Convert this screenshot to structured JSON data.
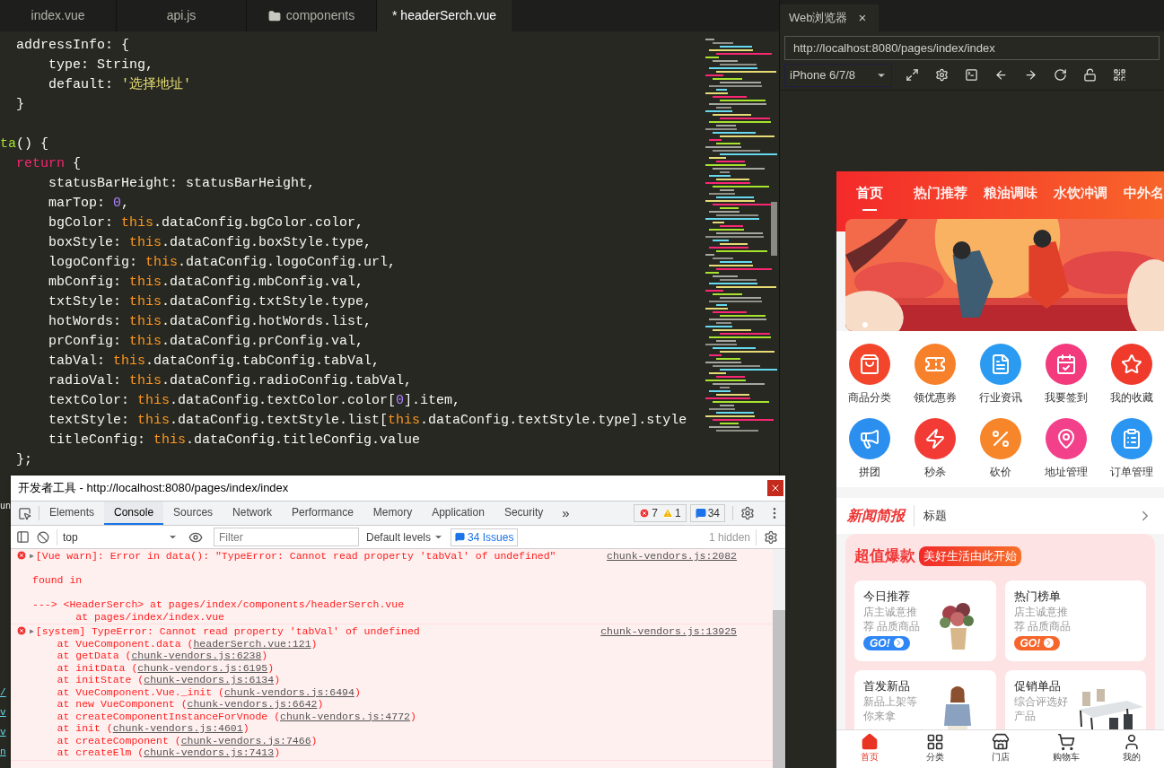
{
  "editor": {
    "tabs": [
      {
        "label": "index.vue",
        "kind": "file",
        "selected": false
      },
      {
        "label": "api.js",
        "kind": "file",
        "selected": false
      },
      {
        "label": "components",
        "kind": "folder",
        "selected": false
      },
      {
        "label": "* headerSerch.vue",
        "kind": "file",
        "selected": true
      }
    ],
    "code_lines": [
      {
        "tokens": [
          {
            "t": "  addressInfo: {",
            "kind": "plain"
          }
        ]
      },
      {
        "tokens": [
          {
            "t": "      type: String,",
            "kind": "plain"
          }
        ]
      },
      {
        "tokens": [
          {
            "t": "      default: ",
            "kind": "plain"
          },
          {
            "t": "'选择地址'",
            "kind": "string"
          }
        ]
      },
      {
        "tokens": [
          {
            "t": "  }",
            "kind": "plain"
          }
        ]
      },
      {
        "space_before": true,
        "tokens": [
          {
            "t": "ta",
            "kind": "func"
          },
          {
            "t": "() {",
            "kind": "plain"
          }
        ]
      },
      {
        "tokens": [
          {
            "t": "  return",
            "kind": "keyword"
          },
          {
            "t": " {",
            "kind": "plain"
          }
        ]
      },
      {
        "tokens": [
          {
            "t": "      statusBarHeight: statusBarHeight,",
            "kind": "plain"
          }
        ]
      },
      {
        "tokens": [
          {
            "t": "      marTop: ",
            "kind": "plain"
          },
          {
            "t": "0",
            "kind": "number"
          },
          {
            "t": ",",
            "kind": "plain"
          }
        ]
      },
      {
        "tokens": [
          {
            "t": "      bgColor: ",
            "kind": "plain"
          },
          {
            "t": "this",
            "kind": "this"
          },
          {
            "t": ".dataConfig.bgColor.color,",
            "kind": "plain"
          }
        ]
      },
      {
        "tokens": [
          {
            "t": "      boxStyle: ",
            "kind": "plain"
          },
          {
            "t": "this",
            "kind": "this"
          },
          {
            "t": ".dataConfig.boxStyle.type,",
            "kind": "plain"
          }
        ]
      },
      {
        "tokens": [
          {
            "t": "      logoConfig: ",
            "kind": "plain"
          },
          {
            "t": "this",
            "kind": "this"
          },
          {
            "t": ".dataConfig.logoConfig.url,",
            "kind": "plain"
          }
        ]
      },
      {
        "tokens": [
          {
            "t": "      mbConfig: ",
            "kind": "plain"
          },
          {
            "t": "this",
            "kind": "this"
          },
          {
            "t": ".dataConfig.mbConfig.val,",
            "kind": "plain"
          }
        ]
      },
      {
        "tokens": [
          {
            "t": "      txtStyle: ",
            "kind": "plain"
          },
          {
            "t": "this",
            "kind": "this"
          },
          {
            "t": ".dataConfig.txtStyle.type,",
            "kind": "plain"
          }
        ]
      },
      {
        "tokens": [
          {
            "t": "      hotWords: ",
            "kind": "plain"
          },
          {
            "t": "this",
            "kind": "this"
          },
          {
            "t": ".dataConfig.hotWords.list,",
            "kind": "plain"
          }
        ]
      },
      {
        "tokens": [
          {
            "t": "      prConfig: ",
            "kind": "plain"
          },
          {
            "t": "this",
            "kind": "this"
          },
          {
            "t": ".dataConfig.prConfig.val,",
            "kind": "plain"
          }
        ]
      },
      {
        "tokens": [
          {
            "t": "      tabVal: ",
            "kind": "plain"
          },
          {
            "t": "this",
            "kind": "this"
          },
          {
            "t": ".dataConfig.tabConfig.tabVal,",
            "kind": "plain"
          }
        ]
      },
      {
        "tokens": [
          {
            "t": "      radioVal: ",
            "kind": "plain"
          },
          {
            "t": "this",
            "kind": "this"
          },
          {
            "t": ".dataConfig.radioConfig.tabVal,",
            "kind": "plain"
          }
        ]
      },
      {
        "tokens": [
          {
            "t": "      textColor: ",
            "kind": "plain"
          },
          {
            "t": "this",
            "kind": "this"
          },
          {
            "t": ".dataConfig.textColor.color[",
            "kind": "plain"
          },
          {
            "t": "0",
            "kind": "number"
          },
          {
            "t": "].item,",
            "kind": "plain"
          }
        ]
      },
      {
        "tokens": [
          {
            "t": "      textStyle: ",
            "kind": "plain"
          },
          {
            "t": "this",
            "kind": "this"
          },
          {
            "t": ".dataConfig.textStyle.list[",
            "kind": "plain"
          },
          {
            "t": "this",
            "kind": "this"
          },
          {
            "t": ".dataConfig.textStyle.type].style",
            "kind": "plain"
          }
        ]
      },
      {
        "tokens": [
          {
            "t": "      titleConfig: ",
            "kind": "plain"
          },
          {
            "t": "this",
            "kind": "this"
          },
          {
            "t": ".dataConfig.titleConfig.value",
            "kind": "plain"
          }
        ]
      },
      {
        "tokens": [
          {
            "t": "  };",
            "kind": "plain"
          }
        ]
      }
    ],
    "fragment": "un",
    "link_fragments": [
      "/",
      "v",
      "v",
      "n"
    ]
  },
  "browser": {
    "tab": "Web浏览器",
    "close": "×",
    "url": "http://localhost:8080/pages/index/index",
    "device": "iPhone 6/7/8",
    "phone": {
      "nav_tabs": [
        {
          "label": "首页",
          "selected": true
        },
        {
          "label": "热门推荐",
          "selected": false
        },
        {
          "label": "粮油调味",
          "selected": false
        },
        {
          "label": "水饮冲调",
          "selected": false
        },
        {
          "label": "中外名",
          "selected": false
        }
      ],
      "shortcuts": [
        {
          "label": "商品分类",
          "color": "#f2452b"
        },
        {
          "label": "领优惠券",
          "color": "#f7812b"
        },
        {
          "label": "行业资讯",
          "color": "#2a9bf0"
        },
        {
          "label": "我要签到",
          "color": "#f23a7c"
        },
        {
          "label": "我的收藏",
          "color": "#f03a2c"
        },
        {
          "label": "拼团",
          "color": "#2b8ff0"
        },
        {
          "label": "秒杀",
          "color": "#f23b35"
        },
        {
          "label": "砍价",
          "color": "#f7862a"
        },
        {
          "label": "地址管理",
          "color": "#f2408a"
        },
        {
          "label": "订单管理",
          "color": "#2a96f2"
        }
      ],
      "news": {
        "title": "新闻简报",
        "headline": "标题"
      },
      "promo": {
        "title": "超值爆款",
        "tag": "美好生活由此开始",
        "cards": [
          {
            "title": "今日推荐",
            "desc": "店主诚意推荐 品质商品",
            "button": "GO!",
            "color": "#2f86f6",
            "kind": "picture"
          },
          {
            "title": "热门榜单",
            "desc": "店主诚意推荐 品质商品",
            "button": "GO!",
            "color": "#f6652a"
          },
          {
            "title": "首发新品",
            "desc": "新品上架等你来拿",
            "kind": "picture"
          },
          {
            "title": "促销单品",
            "desc": "综合评选好产品",
            "kind": "picture"
          }
        ]
      },
      "tabbar": [
        {
          "label": "首页",
          "selected": true
        },
        {
          "label": "分类",
          "selected": false
        },
        {
          "label": "门店",
          "selected": false
        },
        {
          "label": "购物车",
          "selected": false
        },
        {
          "label": "我的",
          "selected": false
        }
      ]
    }
  },
  "devtools": {
    "title": "开发者工具 - http://localhost:8080/pages/index/index",
    "tabs": [
      {
        "label": "Elements",
        "selected": false
      },
      {
        "label": "Console",
        "selected": true
      },
      {
        "label": "Sources",
        "selected": false
      },
      {
        "label": "Network",
        "selected": false
      },
      {
        "label": "Performance",
        "selected": false
      },
      {
        "label": "Memory",
        "selected": false
      },
      {
        "label": "Application",
        "selected": false
      },
      {
        "label": "Security",
        "selected": false
      }
    ],
    "more": "»",
    "badges": [
      {
        "kind": "error",
        "count": "7"
      },
      {
        "kind": "warning",
        "count": "1"
      },
      {
        "kind": "issues",
        "count": "34"
      }
    ],
    "context": "top",
    "filter_placeholder": "Filter",
    "levels": "Default levels",
    "issues_button": "34 Issues",
    "hidden": "1 hidden",
    "messages": [
      {
        "toggle": "▶",
        "head": "[Vue warn]: Error in data(): \"TypeError: Cannot read property 'tabVal' of undefined\"",
        "source": "chunk-vendors.js:2082",
        "lines": [
          {
            "text": "found in",
            "space_before": true
          },
          {
            "text": "---> <HeaderSerch> at pages/index/components/headerSerch.vue",
            "space_before": true
          },
          {
            "text": "       at pages/index/index.vue"
          }
        ]
      },
      {
        "toggle": "▶",
        "head": "[system] TypeError: Cannot read property 'tabVal' of undefined",
        "source": "chunk-vendors.js:13925",
        "lines": [
          {
            "text": "    at VueComponent.data (",
            "link": "headerSerch.vue:121",
            "tail": ")"
          },
          {
            "text": "    at getData (",
            "link": "chunk-vendors.js:6238",
            "tail": ")"
          },
          {
            "text": "    at initData (",
            "link": "chunk-vendors.js:6195",
            "tail": ")"
          },
          {
            "text": "    at initState (",
            "link": "chunk-vendors.js:6134",
            "tail": ")"
          },
          {
            "text": "    at VueComponent.Vue._init (",
            "link": "chunk-vendors.js:6494",
            "tail": ")"
          },
          {
            "text": "    at new VueComponent (",
            "link": "chunk-vendors.js:6642",
            "tail": ")"
          },
          {
            "text": "    at createComponentInstanceForVnode (",
            "link": "chunk-vendors.js:4772",
            "tail": ")"
          },
          {
            "text": "    at init (",
            "link": "chunk-vendors.js:4601",
            "tail": ")"
          },
          {
            "text": "    at createComponent (",
            "link": "chunk-vendors.js:7466",
            "tail": ")"
          },
          {
            "text": "    at createElm (",
            "link": "chunk-vendors.js:7413",
            "tail": ")"
          }
        ]
      }
    ]
  }
}
